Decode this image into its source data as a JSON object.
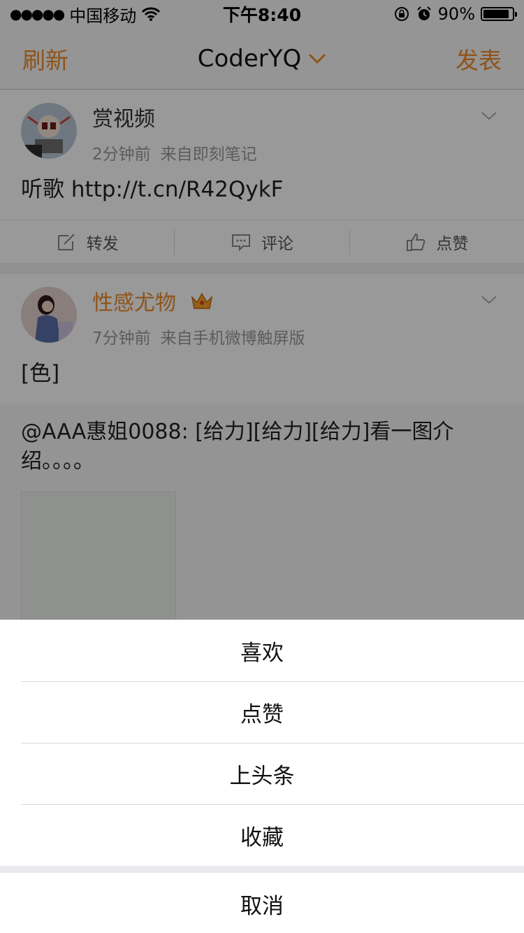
{
  "status_bar": {
    "carrier": "中国移动",
    "time": "下午8:40",
    "battery": "90%",
    "battery_level": 0.9
  },
  "nav": {
    "left": "刷新",
    "title": "CoderYQ",
    "right": "发表"
  },
  "posts": [
    {
      "username": "赏视频",
      "time": "2分钟前",
      "source": "来自即刻笔记",
      "text": "听歌 http://t.cn/R42QykF",
      "actions": {
        "repost": "转发",
        "comment": "评论",
        "like": "点赞"
      }
    },
    {
      "username": "性感尤物",
      "time": "7分钟前",
      "source": "来自手机微博触屏版",
      "text": "[色]",
      "retweet_text": "@AAA惠姐0088: [给力][给力][给力]看一图介绍。。。。"
    }
  ],
  "sheet": {
    "items": [
      "喜欢",
      "点赞",
      "上头条",
      "收藏"
    ],
    "cancel": "取消"
  },
  "colors": {
    "accent": "#ee8b2a",
    "overlay": "rgba(0,0,0,0.4)"
  }
}
